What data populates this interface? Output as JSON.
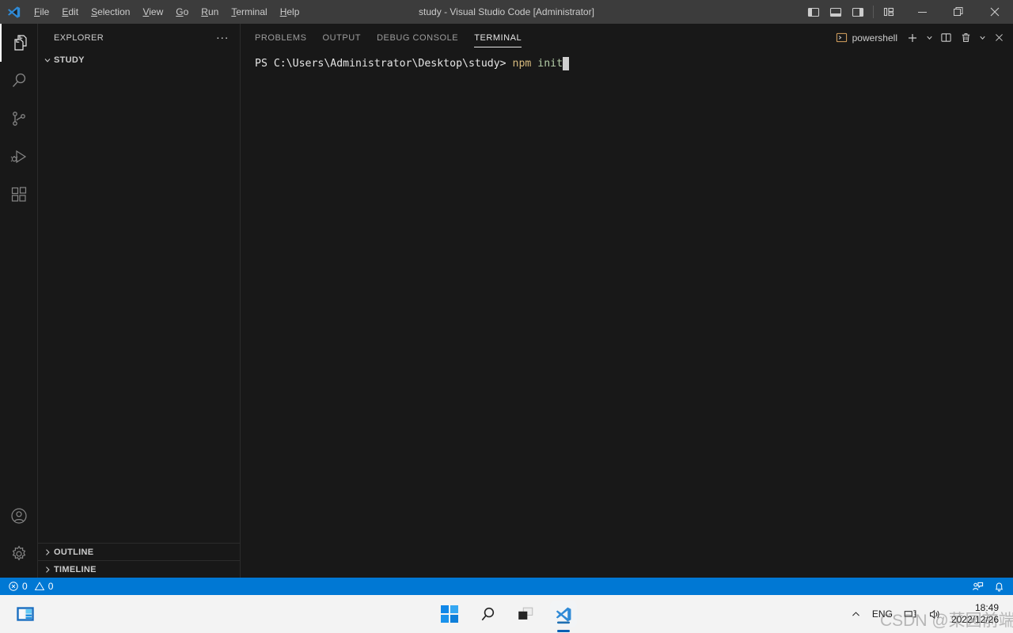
{
  "window": {
    "title": "study - Visual Studio Code [Administrator]",
    "logo_icon": "vscode-logo-icon",
    "menus": [
      {
        "label": "File",
        "accesskey": "F"
      },
      {
        "label": "Edit",
        "accesskey": "E"
      },
      {
        "label": "Selection",
        "accesskey": "S"
      },
      {
        "label": "View",
        "accesskey": "V"
      },
      {
        "label": "Go",
        "accesskey": "G"
      },
      {
        "label": "Run",
        "accesskey": "R"
      },
      {
        "label": "Terminal",
        "accesskey": "T"
      },
      {
        "label": "Help",
        "accesskey": "H"
      }
    ],
    "layout_buttons": [
      {
        "name": "toggle-primary-sidebar-icon",
        "title": "Toggle Primary Side Bar"
      },
      {
        "name": "toggle-panel-icon",
        "title": "Toggle Panel"
      },
      {
        "name": "toggle-secondary-sidebar-icon",
        "title": "Toggle Secondary Side Bar"
      },
      {
        "name": "customize-layout-icon",
        "title": "Customize Layout"
      }
    ],
    "window_buttons": [
      {
        "name": "minimize-button",
        "glyph": "—"
      },
      {
        "name": "maximize-button",
        "glyph": "❐"
      },
      {
        "name": "close-button",
        "glyph": "✕"
      }
    ]
  },
  "activity_bar": {
    "items": [
      {
        "name": "explorer",
        "icon": "files-icon",
        "label": "Explorer",
        "active": true
      },
      {
        "name": "search",
        "icon": "search-icon",
        "label": "Search",
        "active": false
      },
      {
        "name": "source-control",
        "icon": "source-control-icon",
        "label": "Source Control",
        "active": false
      },
      {
        "name": "run-debug",
        "icon": "run-and-debug-icon",
        "label": "Run and Debug",
        "active": false
      },
      {
        "name": "extensions",
        "icon": "extensions-icon",
        "label": "Extensions",
        "active": false
      }
    ],
    "bottom_items": [
      {
        "name": "accounts",
        "icon": "account-icon",
        "label": "Accounts"
      },
      {
        "name": "settings",
        "icon": "gear-icon",
        "label": "Manage"
      }
    ]
  },
  "sidebar": {
    "header": "EXPLORER",
    "more_actions": "···",
    "sections": [
      {
        "label": "STUDY",
        "expanded": true,
        "chevron": "chevron-down-icon"
      }
    ],
    "bottom_sections": [
      {
        "label": "OUTLINE",
        "expanded": false,
        "chevron": "chevron-right-icon"
      },
      {
        "label": "TIMELINE",
        "expanded": false,
        "chevron": "chevron-right-icon"
      }
    ]
  },
  "panel": {
    "tabs": [
      {
        "label": "PROBLEMS",
        "active": false
      },
      {
        "label": "OUTPUT",
        "active": false
      },
      {
        "label": "DEBUG CONSOLE",
        "active": false
      },
      {
        "label": "TERMINAL",
        "active": true
      }
    ],
    "terminal_name": "powershell",
    "actions": [
      {
        "name": "new-terminal-button",
        "icon": "plus-icon"
      },
      {
        "name": "terminal-profile-dropdown-button",
        "icon": "chevron-down-icon"
      },
      {
        "name": "split-terminal-button",
        "icon": "split-icon"
      },
      {
        "name": "kill-terminal-button",
        "icon": "trash-icon"
      },
      {
        "name": "panel-views-button",
        "icon": "chevron-down-icon"
      },
      {
        "name": "close-panel-button",
        "icon": "close-icon"
      }
    ]
  },
  "terminal": {
    "lines": [
      {
        "prompt": "PS C:\\Users\\Administrator\\Desktop\\study> ",
        "command": "npm",
        "args": " init",
        "cursor": true
      }
    ]
  },
  "status_bar": {
    "errors_icon": "error-icon",
    "errors_count": "0",
    "warnings_icon": "warning-icon",
    "warnings_count": "0",
    "right_items": [
      {
        "name": "feedback-icon",
        "label": ""
      },
      {
        "name": "bell-icon",
        "label": ""
      }
    ],
    "accent_color": "#0078d4"
  },
  "taskbar": {
    "widgets_icon": "widgets-icon",
    "center_items": [
      {
        "name": "start-button",
        "icon": "windows-logo-icon",
        "active": false
      },
      {
        "name": "search-button",
        "icon": "search-icon",
        "active": false
      },
      {
        "name": "task-view-button",
        "icon": "task-view-icon",
        "active": false
      },
      {
        "name": "vscode-taskbar-button",
        "icon": "vscode-logo-icon",
        "active": true
      }
    ],
    "tray": {
      "show_hidden_icons": "ⱏ",
      "language": "ENG",
      "network_icon": "network-icon",
      "volume_icon": "volume-icon",
      "time": "18:49",
      "date": "2022/12/26"
    }
  },
  "watermark": "CSDN @菜园前端"
}
